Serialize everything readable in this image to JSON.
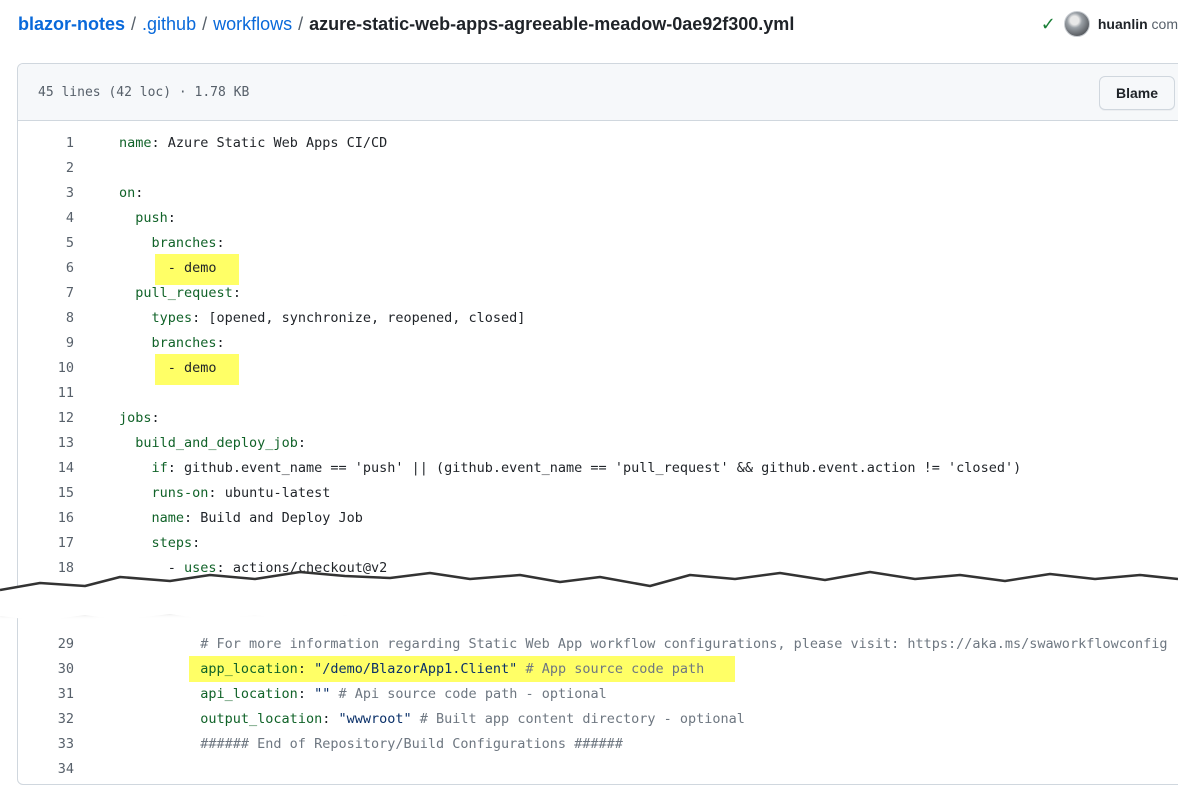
{
  "breadcrumb": {
    "repo": "blazor-notes",
    "folder1": ".github",
    "folder2": "workflows",
    "file": "azure-static-web-apps-agreeable-meadow-0ae92f300.yml"
  },
  "commit": {
    "user": "huanlin",
    "rest": "com"
  },
  "file_meta": "45 lines (42 loc) · 1.78 KB",
  "blame_label": "Blame",
  "lines_top": [
    {
      "n": "1",
      "code": "name: Azure Static Web Apps CI/CD"
    },
    {
      "n": "2",
      "code": ""
    },
    {
      "n": "3",
      "code": "on:"
    },
    {
      "n": "4",
      "code": "  push:"
    },
    {
      "n": "5",
      "code": "    branches:"
    },
    {
      "n": "6",
      "code": "      - demo"
    },
    {
      "n": "7",
      "code": "  pull_request:"
    },
    {
      "n": "8",
      "code": "    types: [opened, synchronize, reopened, closed]"
    },
    {
      "n": "9",
      "code": "    branches:"
    },
    {
      "n": "10",
      "code": "      - demo"
    },
    {
      "n": "11",
      "code": ""
    },
    {
      "n": "12",
      "code": "jobs:"
    },
    {
      "n": "13",
      "code": "  build_and_deploy_job:"
    },
    {
      "n": "14",
      "code": "    if: github.event_name == 'push' || (github.event_name == 'pull_request' && github.event.action != 'closed')"
    },
    {
      "n": "15",
      "code": "    runs-on: ubuntu-latest"
    },
    {
      "n": "16",
      "code": "    name: Build and Deploy Job"
    },
    {
      "n": "17",
      "code": "    steps:"
    },
    {
      "n": "18",
      "code": "      - uses: actions/checkout@v2"
    }
  ],
  "lines_bottom": [
    {
      "n": "29",
      "code": "          # For more information regarding Static Web App workflow configurations, please visit: https://aka.ms/swaworkflowconfig"
    },
    {
      "n": "30",
      "code": "          app_location: \"/demo/BlazorApp1.Client\" # App source code path"
    },
    {
      "n": "31",
      "code": "          api_location: \"\" # Api source code path - optional"
    },
    {
      "n": "32",
      "code": "          output_location: \"wwwroot\" # Built app content directory - optional"
    },
    {
      "n": "33",
      "code": "          ###### End of Repository/Build Configurations ######"
    },
    {
      "n": "34",
      "code": ""
    }
  ],
  "colors": {
    "link": "#0969da",
    "success": "#1a7f37",
    "highlight": "#ffff00"
  }
}
